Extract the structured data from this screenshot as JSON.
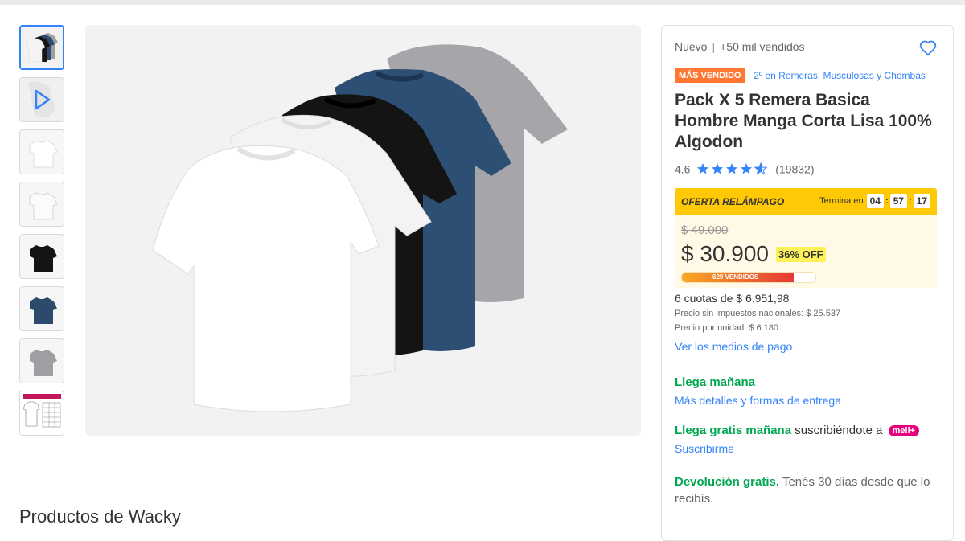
{
  "product": {
    "condition": "Nuevo",
    "sold": "+50 mil vendidos",
    "badge": "MÁS VENDIDO",
    "rank_link": "2º en Remeras, Musculosas y Chombas",
    "title": "Pack X 5 Remera Basica Hombre Manga Corta Lisa 100% Algodon",
    "rating_value": "4.6",
    "rating_count": "(19832)"
  },
  "flash": {
    "label": "OFERTA RELÁMPAGO",
    "ends_label": "Termina en",
    "hours": "04",
    "minutes": "57",
    "seconds": "17"
  },
  "pricing": {
    "old_price": "$ 49.000",
    "price": "$ 30.900",
    "discount": "36% OFF",
    "sold_label": "629 VENDIDOS",
    "installments": "6 cuotas de $ 6.951,98",
    "no_taxes": "Precio sin impuestos nacionales: $ 25.537",
    "unit_price": "Precio por unidad: $ 6.180",
    "payment_link": "Ver los medios de pago"
  },
  "delivery": {
    "arrives": "Llega mañana",
    "details_link": "Más detalles y formas de entrega",
    "free_arrives": "Llega gratis mañana",
    "subscribe_text": "suscribiéndote a",
    "meli_badge": "meli+",
    "subscribe_link": "Suscribirme",
    "returns_bold": "Devolución gratis.",
    "returns_text": "Tenés 30 días desde que lo recibís."
  },
  "seller_section": {
    "title": "Productos de Wacky"
  },
  "colors": {
    "accent": "#3483fa",
    "green": "#00a650",
    "badge_orange": "#ff7733",
    "flash_yellow": "#ffc905"
  },
  "thumbnails": [
    "pack-image",
    "video",
    "white-shirt-front",
    "white-shirt-angle",
    "black-shirt",
    "navy-shirt",
    "gray-shirt",
    "size-chart"
  ]
}
